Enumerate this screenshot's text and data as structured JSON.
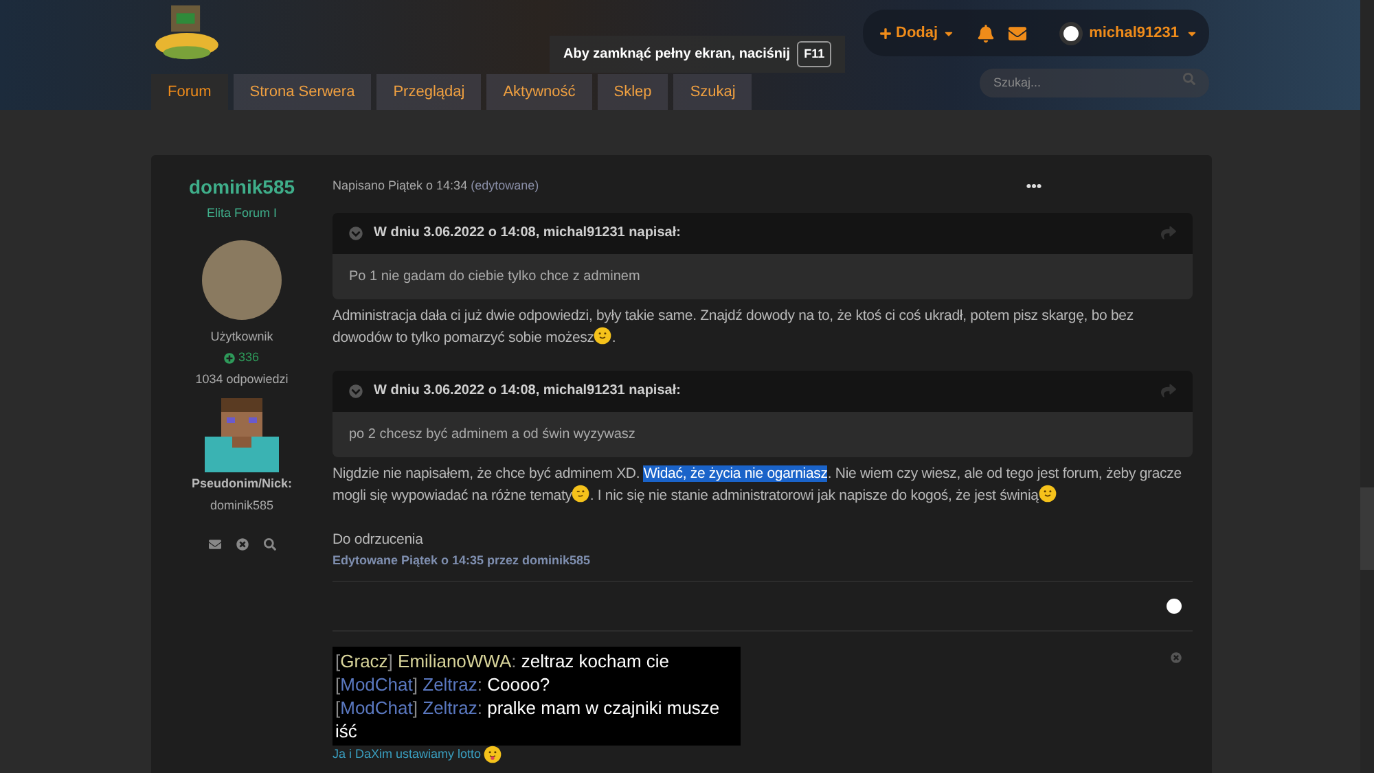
{
  "nav": {
    "tabs": [
      {
        "label": "Forum",
        "selected": true
      },
      {
        "label": "Strona Serwera",
        "selected": false
      },
      {
        "label": "Przeglądaj",
        "selected": false
      },
      {
        "label": "Aktywność",
        "selected": false
      },
      {
        "label": "Sklep",
        "selected": false
      },
      {
        "label": "Szukaj",
        "selected": false
      }
    ]
  },
  "fullscreen_notice": {
    "text": "Aby zamknąć pełny ekran, naciśnij",
    "key": "F11"
  },
  "user_bar": {
    "add_label": "Dodaj",
    "username": "michal91231"
  },
  "search": {
    "placeholder": "Szukaj..."
  },
  "author": {
    "name": "dominik585",
    "rank": "Elita Forum I",
    "group": "Użytkownik",
    "reputation": "336",
    "replies": "1034 odpowiedzi",
    "field_label": "Pseudonim/Nick:",
    "field_value": "dominik585"
  },
  "post": {
    "posted": "Napisano Piątek o 14:34",
    "edited_tag": "(edytowane)",
    "blocks": [
      {
        "kind": "quote",
        "header": "W dniu 3.06.2022 o 14:08, michal91231 napisał:",
        "body": "Po 1 nie gadam do ciebie tylko chce z adminem"
      },
      {
        "kind": "paragraph",
        "parts": [
          {
            "kind": "text",
            "text": "Administracja dała ci już dwie odpowiedzi, były takie same. Znajdź dowody na to, że ktoś ci coś ukradł, potem pisz skargę, bo bez dowodów to tylko pomarzyć sobie możesz",
            "selected": false
          },
          {
            "kind": "smile"
          },
          {
            "kind": "text",
            "text": ".",
            "selected": false
          }
        ]
      },
      {
        "kind": "quote",
        "header": "W dniu 3.06.2022 o 14:08, michal91231 napisał:",
        "body": "po 2 chcesz być adminem a od świn wyzywasz"
      },
      {
        "kind": "paragraph",
        "parts": [
          {
            "kind": "text",
            "text": "Nigdzie nie napisałem, że chce być adminem XD.",
            "selected": false
          },
          {
            "kind": "text",
            "text": "Widać, że życia nie ogarniasz",
            "selected": true
          },
          {
            "kind": "text",
            "text": ". Nie wiem czy wiesz, ale od tego jest forum, żeby gracze mogli się wypowiadać na różne tematy",
            "selected": false
          },
          {
            "kind": "wink"
          },
          {
            "kind": "text",
            "text": ". I nic się nie stanie administratorowi jak napisze do kogoś, że jest świnią",
            "selected": false
          },
          {
            "kind": "smile"
          }
        ]
      },
      {
        "kind": "paragraph",
        "parts": [
          {
            "kind": "text",
            "text": "Do odrzucenia",
            "selected": false
          }
        ]
      }
    ],
    "edit_note": "Edytowane Piątek o 14:35 przez dominik585"
  },
  "signature": {
    "chat": [
      {
        "parts": [
          {
            "text": "[",
            "color": "#8a8a8a"
          },
          {
            "text": "Gracz",
            "color": "#d8d49a"
          },
          {
            "text": "]",
            "color": "#8a8a8a"
          },
          {
            "text": "EmilianoWWA",
            "color": "#d8d49a"
          },
          {
            "text": ":",
            "color": "#8a8a8a"
          },
          {
            "text": "zeltraz kocham cie",
            "color": "#ffffff"
          }
        ]
      },
      {
        "parts": [
          {
            "text": "[",
            "color": "#8a8a8a"
          },
          {
            "text": "ModChat",
            "color": "#5a78c0"
          },
          {
            "text": "]",
            "color": "#8a8a8a"
          },
          {
            "text": "Zeltraz",
            "color": "#5a78c0"
          },
          {
            "text": ":",
            "color": "#8a8a8a"
          },
          {
            "text": "Coooo?",
            "color": "#ffffff"
          }
        ]
      },
      {
        "parts": [
          {
            "text": "[",
            "color": "#8a8a8a"
          },
          {
            "text": "ModChat",
            "color": "#5a78c0"
          },
          {
            "text": "]",
            "color": "#8a8a8a"
          },
          {
            "text": "Zeltraz",
            "color": "#5a78c0"
          },
          {
            "text": ":",
            "color": "#8a8a8a"
          },
          {
            "text": "pralke mam w czajniki musze iść",
            "color": "#ffffff"
          }
        ]
      }
    ],
    "caption": "Ja i DaXim ustawiamy lotto"
  }
}
